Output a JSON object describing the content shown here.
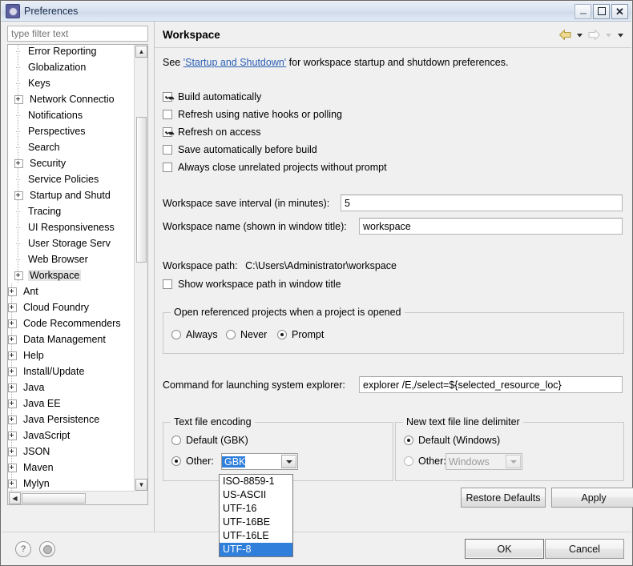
{
  "window": {
    "title": "Preferences",
    "icon": "preferences-icon",
    "minimize_label": "–",
    "maximize_label": "□",
    "close_label": "✕"
  },
  "sidebar": {
    "filter": {
      "placeholder": "type filter text",
      "value": ""
    },
    "items": [
      {
        "label": "Error Reporting",
        "expandable": false,
        "selected": false
      },
      {
        "label": "Globalization",
        "expandable": false,
        "selected": false
      },
      {
        "label": "Keys",
        "expandable": false,
        "selected": false
      },
      {
        "label": "Network Connectio",
        "expandable": true,
        "selected": false
      },
      {
        "label": "Notifications",
        "expandable": false,
        "selected": false
      },
      {
        "label": "Perspectives",
        "expandable": false,
        "selected": false
      },
      {
        "label": "Search",
        "expandable": false,
        "selected": false
      },
      {
        "label": "Security",
        "expandable": true,
        "selected": false
      },
      {
        "label": "Service Policies",
        "expandable": false,
        "selected": false
      },
      {
        "label": "Startup and Shutd",
        "expandable": true,
        "selected": false
      },
      {
        "label": "Tracing",
        "expandable": false,
        "selected": false
      },
      {
        "label": "UI Responsiveness",
        "expandable": false,
        "selected": false
      },
      {
        "label": "User Storage Serv",
        "expandable": false,
        "selected": false
      },
      {
        "label": "Web Browser",
        "expandable": false,
        "selected": false
      },
      {
        "label": "Workspace",
        "expandable": true,
        "selected": true
      }
    ],
    "root_items": [
      {
        "label": "Ant",
        "expandable": true
      },
      {
        "label": "Cloud Foundry",
        "expandable": true
      },
      {
        "label": "Code Recommenders",
        "expandable": true
      },
      {
        "label": "Data Management",
        "expandable": true
      },
      {
        "label": "Help",
        "expandable": true
      },
      {
        "label": "Install/Update",
        "expandable": true
      },
      {
        "label": "Java",
        "expandable": true
      },
      {
        "label": "Java EE",
        "expandable": true
      },
      {
        "label": "Java Persistence",
        "expandable": true
      },
      {
        "label": "JavaScript",
        "expandable": true
      },
      {
        "label": "JSON",
        "expandable": true
      },
      {
        "label": "Maven",
        "expandable": true
      },
      {
        "label": "Mylyn",
        "expandable": true
      }
    ]
  },
  "page": {
    "title": "Workspace",
    "nav": {
      "back_icon": "back-arrow-icon",
      "back_menu_icon": "chevron-down-icon",
      "forward_icon": "forward-arrow-icon",
      "forward_menu_icon": "chevron-down-icon",
      "view_menu_icon": "chevron-down-icon"
    },
    "description": {
      "prefix": "See ",
      "link": "'Startup and Shutdown'",
      "suffix": " for workspace startup and shutdown preferences."
    },
    "checkboxes": [
      {
        "label": "Build automatically",
        "checked": true
      },
      {
        "label": "Refresh using native hooks or polling",
        "checked": false
      },
      {
        "label": "Refresh on access",
        "checked": true
      },
      {
        "label": "Save automatically before build",
        "checked": false
      },
      {
        "label": "Always close unrelated projects without prompt",
        "checked": false
      }
    ],
    "save_interval": {
      "label": "Workspace save interval (in minutes):",
      "value": "5"
    },
    "workspace_name": {
      "label": "Workspace name (shown in window title):",
      "value": "workspace"
    },
    "workspace_path": {
      "label": "Workspace path:",
      "value": "C:\\Users\\Administrator\\workspace"
    },
    "show_path_checkbox": {
      "label": "Show workspace path in window title",
      "checked": false
    },
    "open_referenced": {
      "title": "Open referenced projects when a project is opened",
      "options": [
        {
          "label": "Always",
          "selected": false
        },
        {
          "label": "Never",
          "selected": false
        },
        {
          "label": "Prompt",
          "selected": true
        }
      ]
    },
    "system_explorer": {
      "label": "Command for launching system explorer:",
      "value": "explorer /E,/select=${selected_resource_loc}"
    },
    "text_file_encoding": {
      "title": "Text file encoding",
      "default_option": {
        "label": "Default (GBK)",
        "selected": false
      },
      "other_option": {
        "label": "Other:",
        "selected": true
      },
      "combo_value": "GBK",
      "combo_selected": true,
      "dropdown_open": true,
      "dropdown_items": [
        {
          "label": "ISO-8859-1",
          "highlighted": false
        },
        {
          "label": "US-ASCII",
          "highlighted": false
        },
        {
          "label": "UTF-16",
          "highlighted": false
        },
        {
          "label": "UTF-16BE",
          "highlighted": false
        },
        {
          "label": "UTF-16LE",
          "highlighted": false
        },
        {
          "label": "UTF-8",
          "highlighted": true
        }
      ]
    },
    "line_delimiter": {
      "title": "New text file line delimiter",
      "default_option": {
        "label": "Default (Windows)",
        "selected": true
      },
      "other_option": {
        "label": "Other:",
        "selected": false
      },
      "combo_value": "Windows",
      "combo_disabled": true
    },
    "restore_defaults_label": "Restore Defaults",
    "apply_label": "Apply"
  },
  "footer": {
    "help_icon": "help-icon",
    "shell_icon": "shell-status-icon",
    "ok_label": "OK",
    "cancel_label": "Cancel"
  },
  "colors": {
    "selection_blue": "#2f7fdb",
    "link_blue": "#2b5fb4",
    "back_arrow": "#e8d98a",
    "dialog_bg": "#f0f0f0"
  }
}
